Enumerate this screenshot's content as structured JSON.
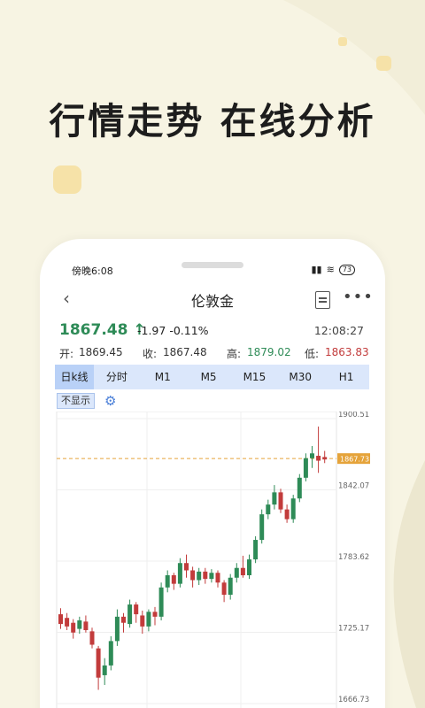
{
  "headline": "行情走势 在线分析",
  "status_bar": {
    "time": "傍晚6:08",
    "signal": "ᖇ᪲",
    "wifi": "≋",
    "battery": "73"
  },
  "nav": {
    "back_icon": "‹",
    "title": "伦敦金",
    "note_icon": "note-icon",
    "more_icon": "•••"
  },
  "quote": {
    "price": "1867.48",
    "arrow": "↑",
    "change": "-1.97 -0.11%",
    "time": "12:08:27",
    "open_label": "开:",
    "open": "1869.45",
    "close_label": "收:",
    "close": "1867.48",
    "high_label": "高:",
    "high": "1879.02",
    "low_label": "低:",
    "low": "1863.83"
  },
  "tabs": [
    "日k线",
    "分时",
    "M1",
    "M5",
    "M15",
    "M30",
    "H1"
  ],
  "active_tab": "日k线",
  "controls": {
    "hide_label": "不显示",
    "settings_icon": "⚙"
  },
  "colors": {
    "up": "#2e8b57",
    "down": "#c23b3b",
    "tab_bg": "#dbe7fb",
    "guide": "#e5a33a"
  },
  "chart_data": {
    "type": "candlestick",
    "y_ticks": [
      "1900.51",
      "1842.07",
      "1783.62",
      "1725.17",
      "1666.73"
    ],
    "y_tick_values": [
      1900.51,
      1842.07,
      1783.62,
      1725.17,
      1666.73
    ],
    "ylim": [
      1666.73,
      1900.51
    ],
    "current_label": "1867.73",
    "current_value": 1867.73,
    "candles": [
      [
        1740,
        1732,
        1745,
        1728
      ],
      [
        1737,
        1730,
        1741,
        1727
      ],
      [
        1733,
        1725,
        1736,
        1720
      ],
      [
        1728,
        1735,
        1738,
        1724
      ],
      [
        1734,
        1727,
        1739,
        1725
      ],
      [
        1726,
        1715,
        1729,
        1712
      ],
      [
        1712,
        1688,
        1714,
        1678
      ],
      [
        1690,
        1698,
        1704,
        1682
      ],
      [
        1698,
        1718,
        1722,
        1694
      ],
      [
        1718,
        1738,
        1744,
        1714
      ],
      [
        1738,
        1733,
        1741,
        1725
      ],
      [
        1732,
        1748,
        1752,
        1729
      ],
      [
        1748,
        1740,
        1750,
        1733
      ],
      [
        1739,
        1730,
        1743,
        1724
      ],
      [
        1730,
        1742,
        1744,
        1726
      ],
      [
        1742,
        1738,
        1746,
        1731
      ],
      [
        1738,
        1762,
        1766,
        1735
      ],
      [
        1762,
        1772,
        1776,
        1758
      ],
      [
        1772,
        1765,
        1774,
        1760
      ],
      [
        1765,
        1782,
        1786,
        1762
      ],
      [
        1782,
        1776,
        1789,
        1770
      ],
      [
        1776,
        1768,
        1779,
        1762
      ],
      [
        1768,
        1775,
        1778,
        1764
      ],
      [
        1775,
        1769,
        1778,
        1765
      ],
      [
        1769,
        1774,
        1777,
        1766
      ],
      [
        1774,
        1766,
        1776,
        1762
      ],
      [
        1766,
        1756,
        1768,
        1750
      ],
      [
        1756,
        1770,
        1773,
        1752
      ],
      [
        1770,
        1778,
        1782,
        1766
      ],
      [
        1778,
        1772,
        1788,
        1770
      ],
      [
        1772,
        1785,
        1789,
        1769
      ],
      [
        1785,
        1801,
        1804,
        1782
      ],
      [
        1801,
        1822,
        1826,
        1798
      ],
      [
        1822,
        1830,
        1834,
        1818
      ],
      [
        1830,
        1840,
        1846,
        1826
      ],
      [
        1840,
        1826,
        1843,
        1823
      ],
      [
        1826,
        1818,
        1830,
        1815
      ],
      [
        1818,
        1835,
        1838,
        1815
      ],
      [
        1835,
        1852,
        1855,
        1832
      ],
      [
        1852,
        1868,
        1872,
        1849
      ],
      [
        1868,
        1872,
        1878,
        1860
      ],
      [
        1870,
        1866,
        1894,
        1856
      ],
      [
        1869,
        1867,
        1874,
        1864
      ]
    ]
  }
}
